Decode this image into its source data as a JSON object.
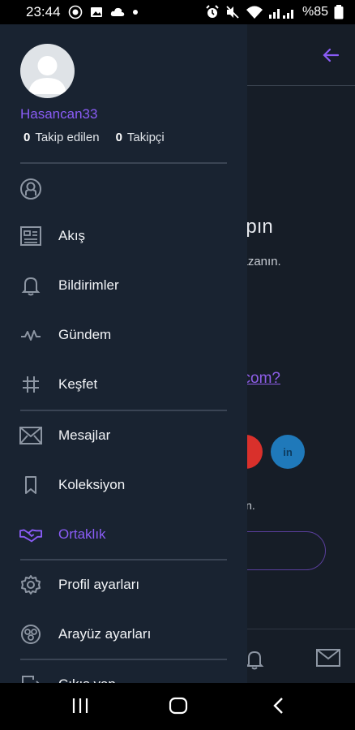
{
  "status_bar": {
    "time": "23:44",
    "battery": "%85",
    "icons": [
      "notification-icon",
      "image-icon",
      "cloud-icon",
      "dot-icon",
      "alarm-icon",
      "mute-icon",
      "wifi-icon",
      "signal-icon",
      "battery-icon"
    ]
  },
  "drawer": {
    "username": "Hasancan33",
    "following_count": "0",
    "following_label": "Takip edilen",
    "followers_count": "0",
    "followers_label": "Takipçi",
    "menu": [
      {
        "label": "",
        "icon": "profile-icon"
      },
      {
        "label": "Akış",
        "icon": "feed-icon"
      },
      {
        "label": "Bildirimler",
        "icon": "bell-icon"
      },
      {
        "label": "Gündem",
        "icon": "pulse-icon"
      },
      {
        "label": "Keşfet",
        "icon": "hashtag-icon"
      },
      {
        "label": "Mesajlar",
        "icon": "mail-icon"
      },
      {
        "label": "Koleksiyon",
        "icon": "bookmark-icon"
      },
      {
        "label": "Ortaklık",
        "icon": "handshake-icon"
      },
      {
        "label": "Profil ayarları",
        "icon": "gear-icon"
      },
      {
        "label": "Arayüz ayarları",
        "icon": "palette-icon"
      },
      {
        "label": "Çıkış yap",
        "icon": "logout-icon"
      }
    ],
    "active_color": "#8a5cf6"
  },
  "background": {
    "headline_fragment": "apın",
    "sub_fragment": "kazanın.",
    "link_fragment": "l.com?",
    "social_blue_label": "in",
    "small_fragment": "in."
  },
  "nav_bar": {
    "buttons": [
      "recents-button",
      "home-button",
      "back-button"
    ]
  }
}
